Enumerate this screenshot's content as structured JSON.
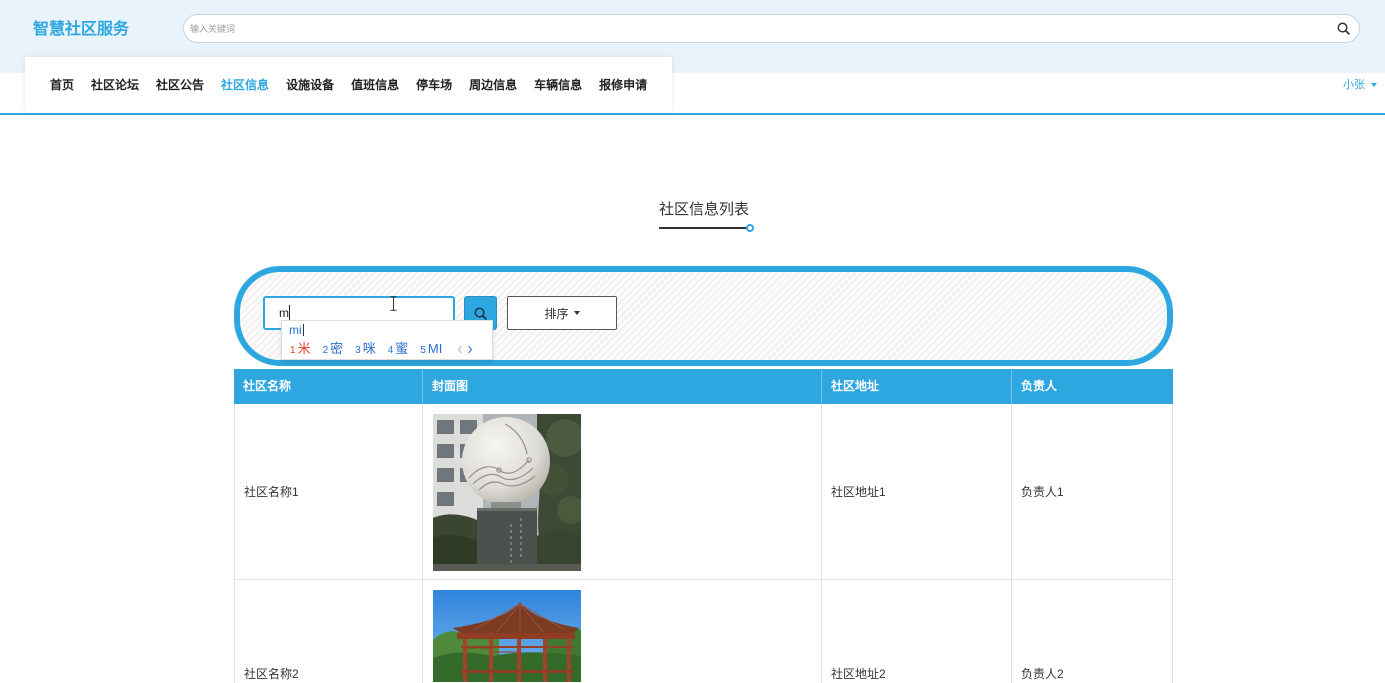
{
  "header": {
    "logo": "智慧社区服务",
    "search_placeholder": "输入关键词"
  },
  "nav": {
    "items": [
      {
        "label": "首页",
        "active": false
      },
      {
        "label": "社区论坛",
        "active": false
      },
      {
        "label": "社区公告",
        "active": false
      },
      {
        "label": "社区信息",
        "active": true
      },
      {
        "label": "设施设备",
        "active": false
      },
      {
        "label": "值班信息",
        "active": false
      },
      {
        "label": "停车场",
        "active": false
      },
      {
        "label": "周边信息",
        "active": false
      },
      {
        "label": "车辆信息",
        "active": false
      },
      {
        "label": "报修申请",
        "active": false
      }
    ],
    "user_name": "小张"
  },
  "page_title": "社区信息列表",
  "filter": {
    "search_value": "m",
    "sort_label": "排序"
  },
  "ime": {
    "composition": "mi",
    "candidates": [
      {
        "index": "1",
        "text": "米",
        "selected": true
      },
      {
        "index": "2",
        "text": "密",
        "selected": false
      },
      {
        "index": "3",
        "text": "咪",
        "selected": false
      },
      {
        "index": "4",
        "text": "蜜",
        "selected": false
      },
      {
        "index": "5",
        "text": "MI",
        "selected": false
      }
    ]
  },
  "table": {
    "columns": [
      "社区名称",
      "封面图",
      "社区地址",
      "负责人"
    ],
    "rows": [
      {
        "name": "社区名称1",
        "address": "社区地址1",
        "manager": "负责人1"
      },
      {
        "name": "社区名称2",
        "address": "社区地址2",
        "manager": "负责人2"
      }
    ]
  },
  "icons": {
    "global_search": "search-icon",
    "filter_search": "search-icon",
    "sort_caret": "caret-down-icon",
    "user_caret": "caret-down-icon",
    "ime_prev": "chevron-left-icon",
    "ime_next": "chevron-right-icon"
  },
  "colors": {
    "accent": "#2ea7e0",
    "header_bg": "#e8f3fb",
    "text": "#333333",
    "border": "#e3e3e3",
    "ime_selected": "#e5432a",
    "ime_normal": "#2a6fcf"
  }
}
